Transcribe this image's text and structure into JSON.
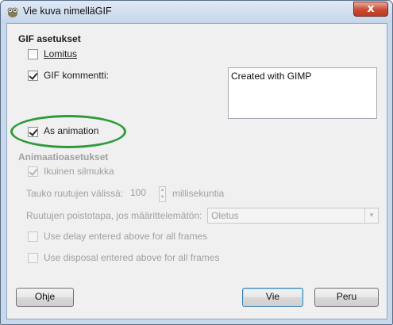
{
  "window": {
    "title": "Vie kuva nimelläGIF",
    "close_glyph": "x",
    "app_icon": "gimp-icon"
  },
  "gif_settings": {
    "heading": "GIF asetukset",
    "interlace": {
      "label": "Lomitus",
      "checked": false
    },
    "comment": {
      "label": "GIF kommentti:",
      "checked": true,
      "value": "Created with GIMP"
    },
    "as_animation": {
      "label": "As animation",
      "checked": true,
      "highlight_color": "#2f9a3a"
    }
  },
  "animation_settings": {
    "heading": "Animaatioasetukset",
    "loop_forever": {
      "label": "Ikuinen silmukka",
      "checked": true
    },
    "delay": {
      "label": "Tauko ruutujen välissä:",
      "value": "100",
      "unit": "millisekuntia"
    },
    "disposal": {
      "label": "Ruutujen poistotapa, jos määrittelemätön:",
      "value": "Oletus"
    },
    "use_delay_all": {
      "label": "Use delay entered above for all frames",
      "checked": false
    },
    "use_disposal_all": {
      "label": "Use disposal entered above for all frames",
      "checked": false
    }
  },
  "buttons": {
    "help": "Ohje",
    "export": "Vie",
    "cancel": "Peru"
  }
}
